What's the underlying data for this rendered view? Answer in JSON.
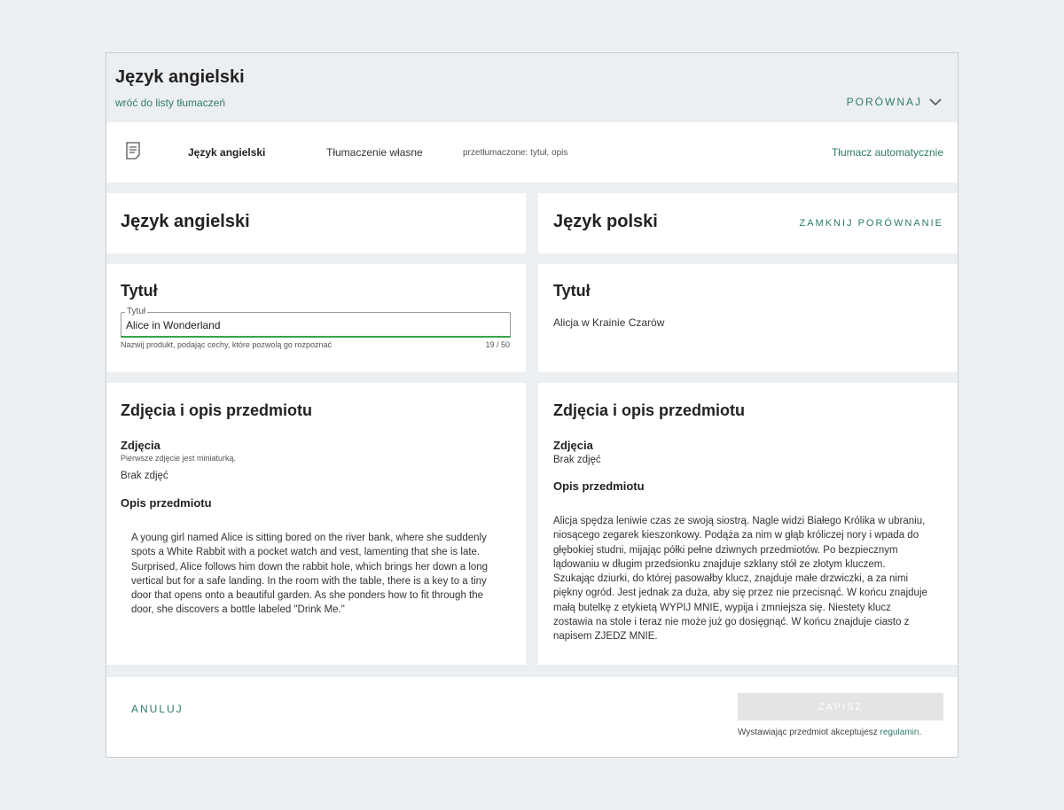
{
  "header": {
    "title": "Język angielski",
    "back_link": "wróć do listy tłumaczeń",
    "compare": "PORÓWNAJ"
  },
  "infobar": {
    "language": "Język angielski",
    "type": "Tłumaczenie własne",
    "translated": "przetłumaczone: tytuł, opis",
    "auto_translate": "Tłumacz automatycznie",
    "icon": "document-icon"
  },
  "left": {
    "heading": "Język angielski",
    "title_section": {
      "heading": "Tytuł",
      "field_label": "Tytuł",
      "value": "Alice in Wonderland",
      "hint": "Nazwij produkt, podając cechy, które pozwolą go rozpoznać",
      "counter": "19  /  50"
    },
    "desc_section": {
      "heading": "Zdjęcia i opis przedmiotu",
      "photos_label": "Zdjęcia",
      "photos_hint": "Pierwsze zdjęcie jest miniaturką.",
      "no_photos": "Brak zdjęć",
      "desc_label": "Opis przedmiotu",
      "description": "A young girl named Alice is sitting bored on the river bank, where she suddenly spots a White Rabbit with a pocket watch and vest, lamenting that she is late. Surprised, Alice follows him down the rabbit hole, which brings her down a long vertical but for a safe landing. In the room with the table, there is a key to a tiny door that opens onto a beautiful garden. As she ponders how to fit through the door, she discovers a bottle labeled \"Drink Me.\""
    }
  },
  "right": {
    "heading": "Język polski",
    "close_compare": "ZAMKNIJ PORÓWNANIE",
    "title_section": {
      "heading": "Tytuł",
      "value": "Alicja w Krainie Czarów"
    },
    "desc_section": {
      "heading": "Zdjęcia i opis przedmiotu",
      "photos_label": "Zdjęcia",
      "no_photos": "Brak zdjęć",
      "desc_label": "Opis przedmiotu",
      "description": "Alicja spędza leniwie czas ze swoją siostrą. Nagle widzi Białego Królika w ubraniu, niosącego zegarek kieszonkowy. Podąża za nim w głąb króliczej nory i wpada do głębokiej studni, mijając półki pełne dziwnych przedmiotów. Po bezpiecznym lądowaniu w długim przedsionku znajduje szklany stół ze złotym kluczem. Szukając dziurki, do której pasowałby klucz, znajduje małe drzwiczki, a za nimi piękny ogród. Jest jednak za duża, aby się przez nie przecisnąć. W końcu znajduje małą butelkę z etykietą WYPIJ MNIE, wypija i zmniejsza się. Niestety klucz zostawia na stole i teraz nie może już go dosięgnąć. W końcu znajduje ciasto z napisem ZJEDZ MNIE."
    }
  },
  "footer": {
    "cancel": "ANULUJ",
    "save": "ZAPISZ",
    "terms_prefix": "Wystawiając przedmiot akceptujesz ",
    "terms_link": "regulamin",
    "terms_suffix": "."
  },
  "colors": {
    "accent": "#2f7a6b",
    "input_underline": "#3aa34a",
    "background": "#eceff2"
  }
}
